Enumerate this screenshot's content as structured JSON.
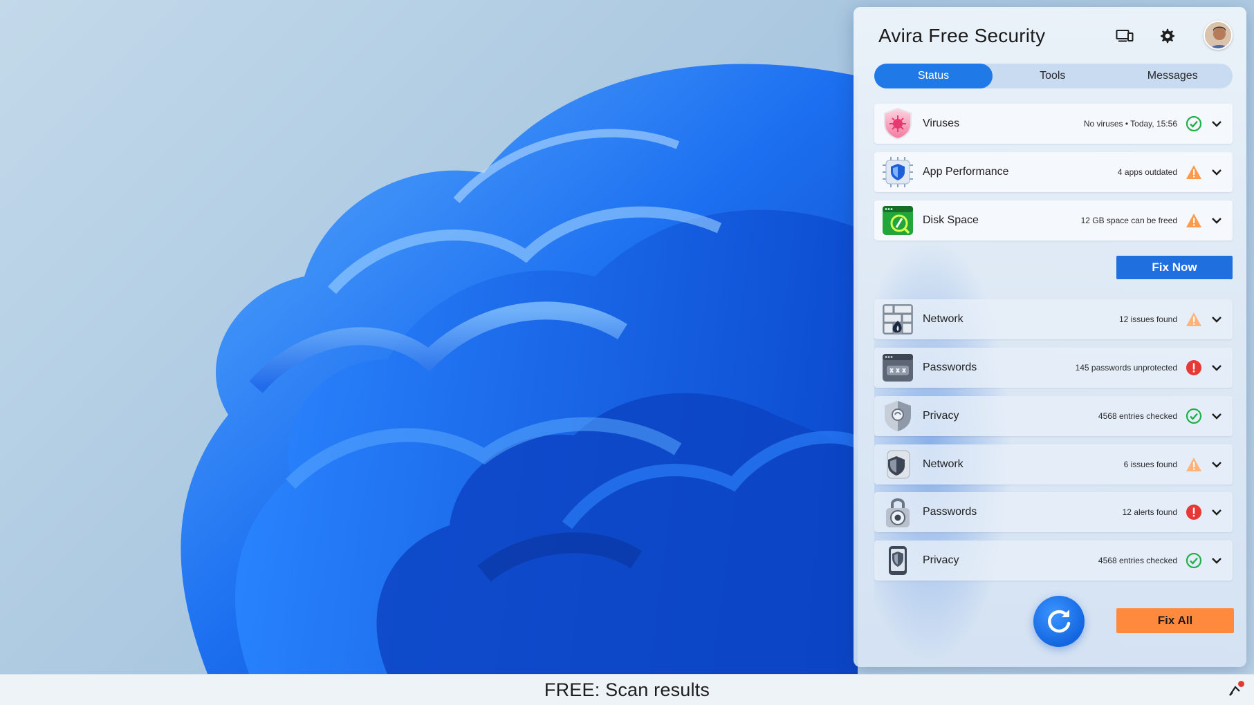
{
  "app": {
    "title": "Avira Free Security"
  },
  "header": {
    "icons": [
      "devices-icon",
      "gear-icon"
    ],
    "avatar": "avatar"
  },
  "tabs": [
    {
      "label": "Status",
      "active": true
    },
    {
      "label": "Tools",
      "active": false
    },
    {
      "label": "Messages",
      "active": false
    }
  ],
  "rows": [
    {
      "label": "Viruses",
      "status": "No viruses • Today, 15:56",
      "state": "ok",
      "icon": "virus-shield-icon"
    },
    {
      "label": "App Performance",
      "status": "4 apps outdated",
      "state": "warning",
      "icon": "chip-shield-icon"
    },
    {
      "label": "Disk Space",
      "status": "12 GB space can be freed",
      "state": "warning",
      "icon": "disk-space-icon"
    },
    {
      "label": "Network",
      "status": "12 issues found",
      "state": "warning",
      "icon": "firewall-icon"
    },
    {
      "label": "Passwords",
      "status": "145 passwords unprotected",
      "state": "error",
      "icon": "password-manager-icon"
    },
    {
      "label": "Privacy",
      "status": "4568 entries checked",
      "state": "ok",
      "icon": "privacy-shield-icon"
    },
    {
      "label": "Network",
      "status": "6 issues found",
      "state": "warning",
      "icon": "network-shield-icon"
    },
    {
      "label": "Passwords",
      "status": "12 alerts found",
      "state": "error",
      "icon": "lock-eye-icon"
    },
    {
      "label": "Privacy",
      "status": "4568 entries checked",
      "state": "ok",
      "icon": "phone-shield-icon"
    }
  ],
  "buttons": {
    "fix_now": "Fix Now",
    "fix_all": "Fix All"
  },
  "taskbar": {
    "title": "FREE: Scan results"
  },
  "colors": {
    "accent": "#1f7ae8",
    "ok": "#20b04b",
    "warning": "#ff8a3d",
    "error": "#e53935",
    "fix_all": "#ff8a3d"
  }
}
